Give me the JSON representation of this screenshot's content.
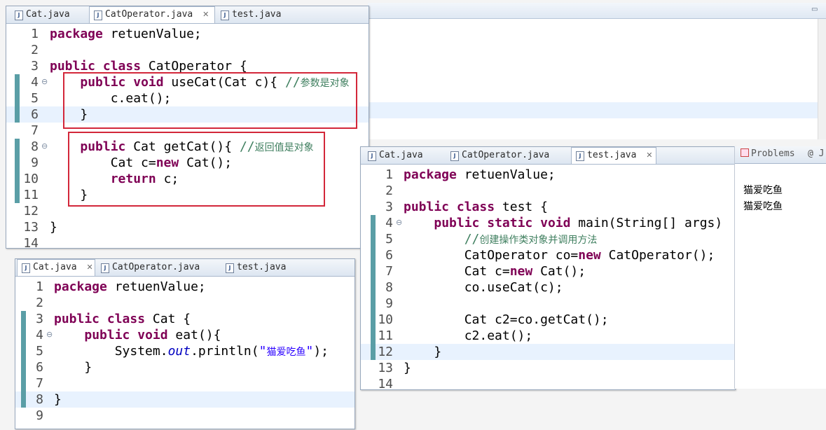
{
  "editors": {
    "operator": {
      "tabs": [
        {
          "label": "Cat.java",
          "active": false
        },
        {
          "label": "CatOperator.java",
          "active": true
        },
        {
          "label": "test.java",
          "active": false
        }
      ],
      "lines": [
        {
          "n": "1",
          "code": "package retuenValue;"
        },
        {
          "n": "2",
          "code": ""
        },
        {
          "n": "3",
          "code": "public class CatOperator {"
        },
        {
          "n": "4",
          "code": "    public void useCat(Cat c){ ",
          "comment": "//参数是对象"
        },
        {
          "n": "5",
          "code": "        c.eat();"
        },
        {
          "n": "6",
          "code": "    }"
        },
        {
          "n": "7",
          "code": ""
        },
        {
          "n": "8",
          "code": "    public Cat getCat(){ ",
          "comment": "//返回值是对象"
        },
        {
          "n": "9",
          "code": "        Cat c=new Cat();"
        },
        {
          "n": "10",
          "code": "        return c;"
        },
        {
          "n": "11",
          "code": "    }"
        },
        {
          "n": "12",
          "code": ""
        },
        {
          "n": "13",
          "code": "}"
        },
        {
          "n": "14",
          "code": ""
        }
      ]
    },
    "cat": {
      "tabs": [
        {
          "label": "Cat.java",
          "active": true
        },
        {
          "label": "CatOperator.java",
          "active": false
        },
        {
          "label": "test.java",
          "active": false
        }
      ],
      "lines": [
        {
          "n": "1",
          "code": "package retuenValue;"
        },
        {
          "n": "2",
          "code": ""
        },
        {
          "n": "3",
          "code": "public class Cat {"
        },
        {
          "n": "4",
          "code": "    public void eat(){"
        },
        {
          "n": "5",
          "code": "        System.out.println(\"猫爱吃鱼\");"
        },
        {
          "n": "6",
          "code": "    }"
        },
        {
          "n": "7",
          "code": ""
        },
        {
          "n": "8",
          "code": "}"
        },
        {
          "n": "9",
          "code": ""
        }
      ]
    },
    "test": {
      "tabs": [
        {
          "label": "Cat.java",
          "active": false
        },
        {
          "label": "CatOperator.java",
          "active": false
        },
        {
          "label": "test.java",
          "active": true
        }
      ],
      "lines": [
        {
          "n": "1",
          "code": "package retuenValue;"
        },
        {
          "n": "2",
          "code": ""
        },
        {
          "n": "3",
          "code": "public class test {"
        },
        {
          "n": "4",
          "code": "    public static void main(String[] args)"
        },
        {
          "n": "5",
          "code": "        ",
          "comment": "//创建操作类对象并调用方法"
        },
        {
          "n": "6",
          "code": "        CatOperator co=new CatOperator();"
        },
        {
          "n": "7",
          "code": "        Cat c=new Cat();"
        },
        {
          "n": "8",
          "code": "        co.useCat(c);"
        },
        {
          "n": "9",
          "code": ""
        },
        {
          "n": "10",
          "code": "        Cat c2=co.getCat();"
        },
        {
          "n": "11",
          "code": "        c2.eat();"
        },
        {
          "n": "12",
          "code": "    }"
        },
        {
          "n": "13",
          "code": "}"
        },
        {
          "n": "14",
          "code": ""
        }
      ]
    }
  },
  "side_panel": {
    "tabs": [
      "Problems",
      "@ J"
    ],
    "console_output": [
      "猫爱吃鱼",
      "猫爱吃鱼"
    ]
  }
}
